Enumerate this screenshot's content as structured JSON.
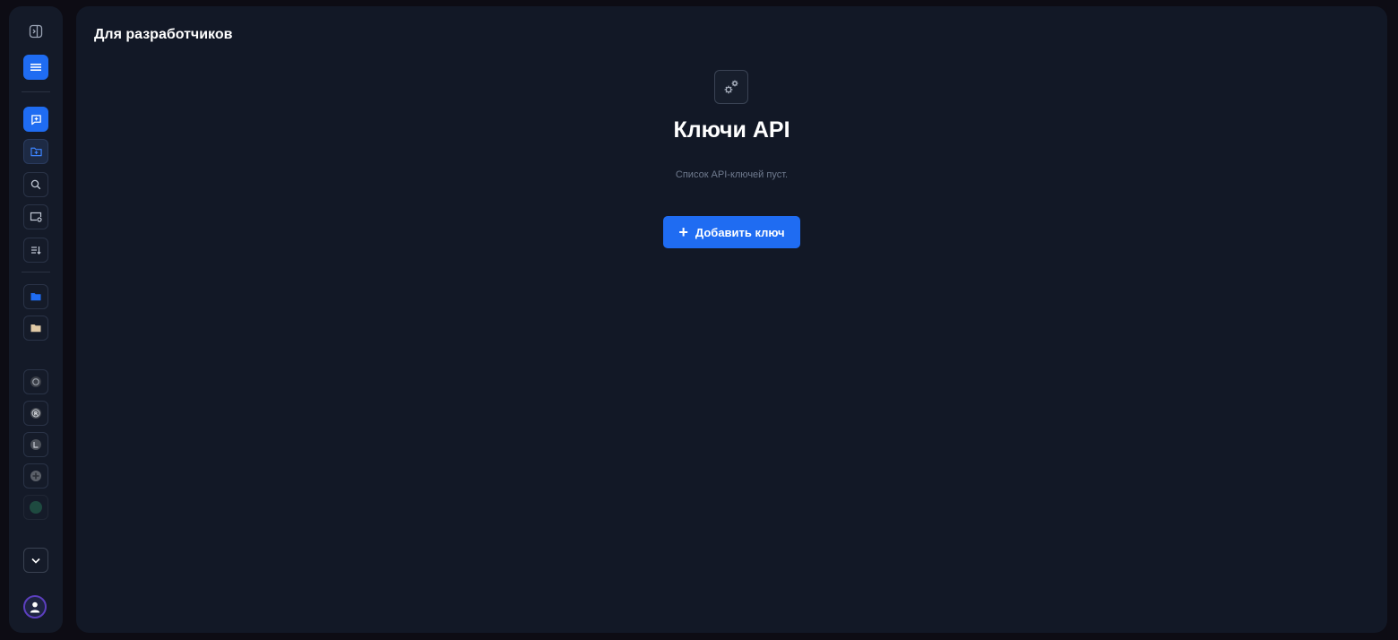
{
  "header": {
    "title": "Для разработчиков"
  },
  "empty_state": {
    "icon": "gears-icon",
    "title": "Ключи API",
    "subtitle": "Список API-ключей пуст.",
    "add_button_label": "Добавить ключ",
    "add_button_icon": "plus-icon"
  },
  "sidebar": {
    "top_icons": [
      "sidebar-toggle-icon",
      "menu-icon"
    ],
    "tool_icons": [
      "new-chat-icon",
      "new-folder-icon",
      "search-icon",
      "screen-settings-icon",
      "sort-list-icon"
    ],
    "folder_colors": [
      "#1f6cf2",
      "#e0c9a6"
    ],
    "models": [
      "openai-icon",
      "r-model-icon",
      "grok-icon",
      "plus-model-icon",
      "teal-model-icon"
    ],
    "expand_icon": "chevron-down-icon",
    "user_icon": "user-avatar-icon"
  },
  "colors": {
    "accent": "#1f6cf2",
    "background": "#121826",
    "sidebar": "#141a28"
  }
}
